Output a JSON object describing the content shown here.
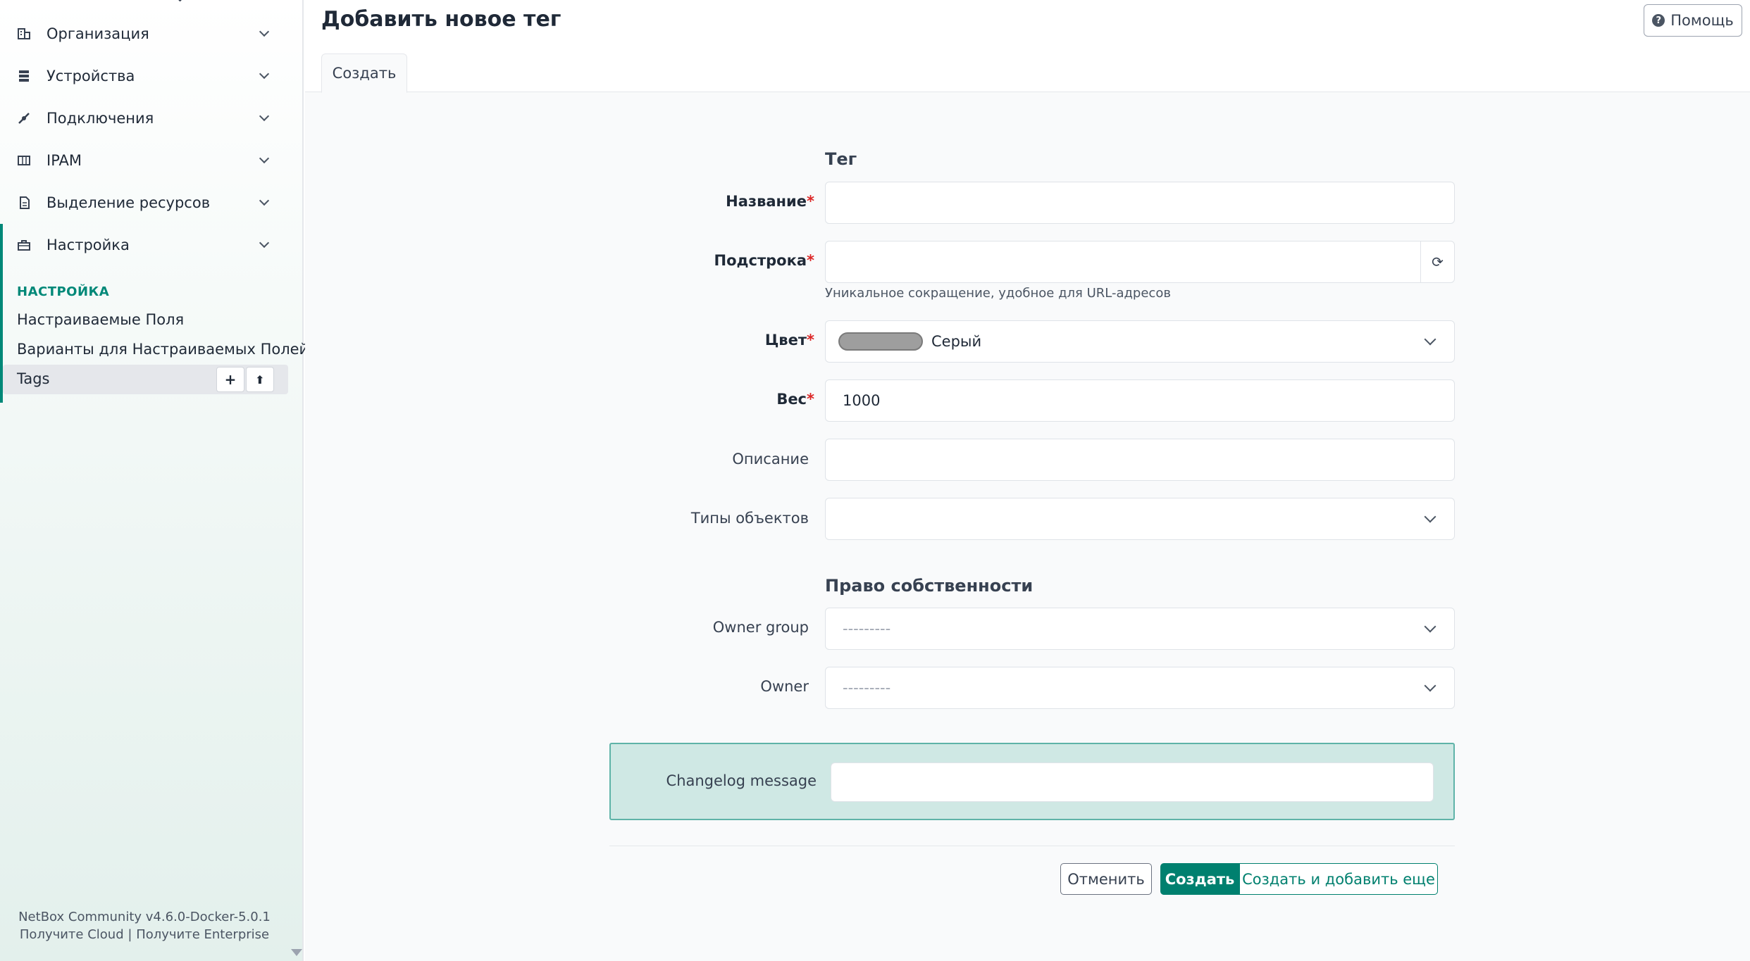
{
  "sidebar": {
    "menu": [
      {
        "label": "Организация",
        "icon": "domain-icon"
      },
      {
        "label": "Устройства",
        "icon": "server-icon"
      },
      {
        "label": "Подключения",
        "icon": "connection-icon"
      },
      {
        "label": "IPAM",
        "icon": "counter-icon"
      },
      {
        "label": "Выделение ресурсов",
        "icon": "file-document-icon"
      },
      {
        "label": "Настройка",
        "icon": "toolbox-icon"
      }
    ],
    "section_heading": "НАСТРОЙКА",
    "links": [
      "Настраиваемые Поля",
      "Варианты для Настраиваемых Полей"
    ],
    "active_item": {
      "label": "Tags",
      "add_icon": "+",
      "import_icon": "⬆"
    },
    "footer": {
      "version": "NetBox Community v4.6.0-Docker-5.0.1",
      "cloud_link": "Получите Cloud",
      "separator": "|",
      "enterprise_link": "Получите Enterprise"
    }
  },
  "header": {
    "title": "Добавить новое тег",
    "help_button": "Помощь"
  },
  "tabs": [
    "Создать"
  ],
  "form": {
    "section_tag": "Тег",
    "name": {
      "label": "Название",
      "required_mark": "*",
      "value": ""
    },
    "slug": {
      "label": "Подстрока",
      "required_mark": "*",
      "value": "",
      "hint": "Уникальное сокращение, удобное для URL-адресов"
    },
    "color": {
      "label": "Цвет",
      "required_mark": "*",
      "value": "Серый",
      "swatch": "#9e9e9e"
    },
    "weight": {
      "label": "Вес",
      "required_mark": "*",
      "value": "1000"
    },
    "description": {
      "label": "Описание",
      "value": ""
    },
    "object_types": {
      "label": "Типы объектов",
      "value": ""
    },
    "section_ownership": "Право собственности",
    "owner_group": {
      "label": "Owner group",
      "value": "---------"
    },
    "owner": {
      "label": "Owner",
      "value": "---------"
    },
    "changelog": {
      "label": "Changelog message",
      "value": ""
    }
  },
  "buttons": {
    "cancel": "Отменить",
    "create": "Создать",
    "create_and_add": "Создать и добавить еще"
  },
  "colors": {
    "accent": "#00806f",
    "required": "#dc2626"
  }
}
